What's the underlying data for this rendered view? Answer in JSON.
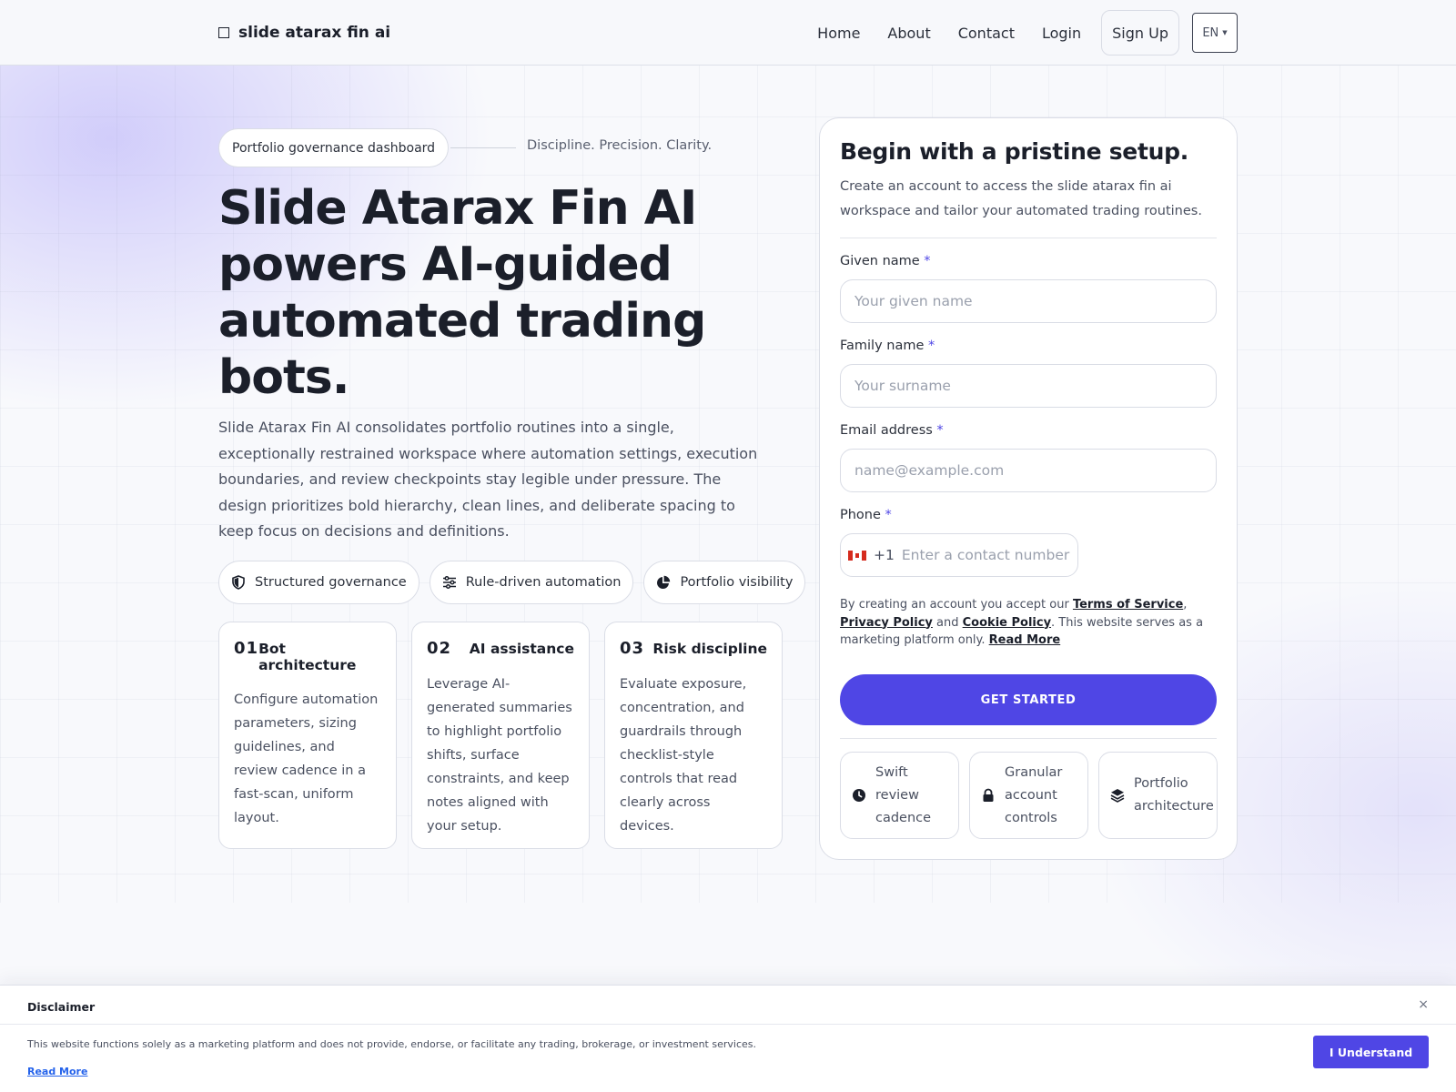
{
  "nav": {
    "brand": "slide atarax fin ai",
    "links": [
      "Home",
      "About",
      "Contact",
      "Login"
    ],
    "signup": "Sign Up",
    "language": "EN"
  },
  "hero": {
    "pill": "Portfolio governance dashboard",
    "tagline": "Discipline. Precision. Clarity.",
    "title": "Slide Atarax Fin AI powers AI-guided automated trading bots.",
    "description": "Slide Atarax Fin AI consolidates portfolio routines into a single, exceptionally restrained workspace where automation settings, execution boundaries, and review checkpoints stay legible under pressure. The design prioritizes bold hierarchy, clean lines, and deliberate spacing to keep focus on decisions and definitions.",
    "chips": [
      {
        "label": "Structured governance",
        "icon": "shield-icon"
      },
      {
        "label": "Rule-driven automation",
        "icon": "sliders-icon"
      },
      {
        "label": "Portfolio visibility",
        "icon": "pie-chart-icon"
      }
    ],
    "cards": [
      {
        "num": "01",
        "title": "Bot architecture",
        "body": "Configure automation parameters, sizing guidelines, and review cadence in a fast-scan, uniform layout."
      },
      {
        "num": "02",
        "title": "AI assistance",
        "body": "Leverage AI-generated summaries to highlight portfolio shifts, surface constraints, and keep notes aligned with your setup."
      },
      {
        "num": "03",
        "title": "Risk discipline",
        "body": "Evaluate exposure, concentration, and guardrails through checklist-style controls that read clearly across devices."
      }
    ]
  },
  "form": {
    "title": "Begin with a pristine setup.",
    "subtitle": "Create an account to access the slide atarax fin ai workspace and tailor your automated trading routines.",
    "required_mark": "*",
    "given_label": "Given name",
    "given_placeholder": "Your given name",
    "family_label": "Family name",
    "family_placeholder": "Your surname",
    "email_label": "Email address",
    "email_placeholder": "name@example.com",
    "phone_label": "Phone",
    "phone_dial": "+1",
    "phone_placeholder": "Enter a contact number",
    "legal": {
      "prefix": "By creating an account you accept our ",
      "terms": "Terms of Service",
      "comma": ", ",
      "privacy": "Privacy Policy",
      "and": " and ",
      "cookie": "Cookie Policy",
      "suffix": ". This website serves as a marketing platform only. ",
      "read_more": "Read More"
    },
    "cta": "GET STARTED",
    "features": [
      {
        "label": "Swift review cadence",
        "icon": "clock-icon"
      },
      {
        "label": "Granular account controls",
        "icon": "lock-icon"
      },
      {
        "label": "Portfolio architecture",
        "icon": "layers-icon"
      }
    ]
  },
  "disclaimer": {
    "title": "Disclaimer",
    "close": "×",
    "text": "This website functions solely as a marketing platform and does not provide, endorse, or facilitate any trading, brokerage, or investment services.",
    "read_more": "Read More",
    "button": "I Understand"
  },
  "colors": {
    "accent": "#4f46e5",
    "text": "#1b1f2a",
    "link": "#2563eb"
  }
}
